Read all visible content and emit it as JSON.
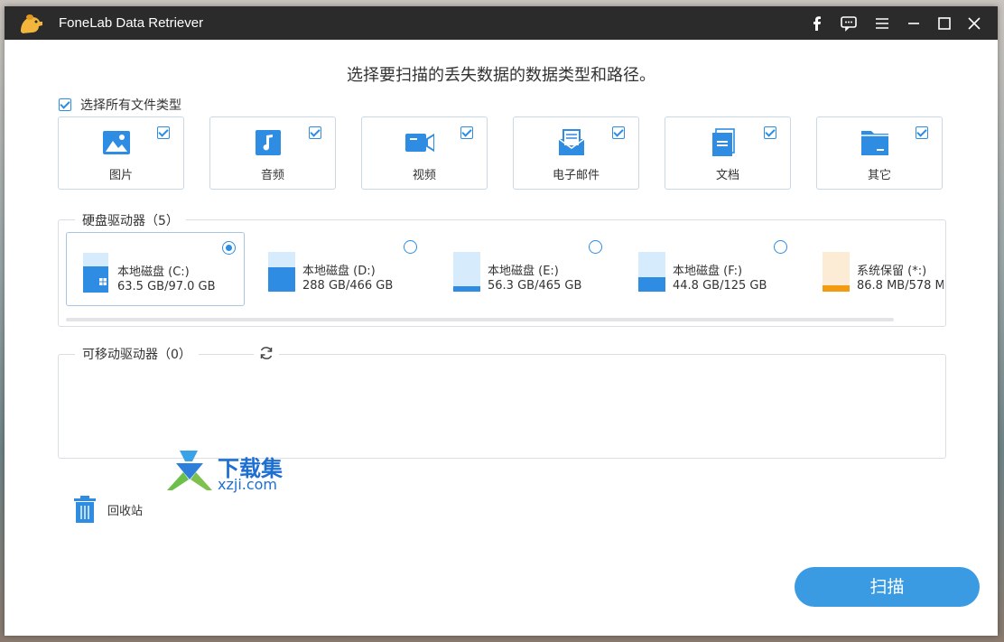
{
  "app": {
    "title": "FoneLab Data Retriever"
  },
  "titlebar_icons": [
    "facebook-icon",
    "feedback-icon",
    "menu-icon",
    "minimize-icon",
    "maximize-icon",
    "close-icon"
  ],
  "headline": "选择要扫描的丢失数据的数据类型和路径。",
  "select_all": {
    "label": "选择所有文件类型",
    "checked": true
  },
  "file_types": [
    {
      "label": "图片",
      "icon": "image-icon",
      "checked": true
    },
    {
      "label": "音频",
      "icon": "music-icon",
      "checked": true
    },
    {
      "label": "视频",
      "icon": "video-icon",
      "checked": true
    },
    {
      "label": "电子邮件",
      "icon": "email-icon",
      "checked": true
    },
    {
      "label": "文档",
      "icon": "document-icon",
      "checked": true
    },
    {
      "label": "其它",
      "icon": "other-icon",
      "checked": true
    }
  ],
  "hard_drives": {
    "title": "硬盘驱动器（5）",
    "items": [
      {
        "name": "本地磁盘 (C:)",
        "size": "63.5 GB/97.0 GB",
        "used_fraction": 0.65,
        "selected": true,
        "windows": true,
        "color": "#2e8ce2"
      },
      {
        "name": "本地磁盘 (D:)",
        "size": "288 GB/466 GB",
        "used_fraction": 0.62,
        "selected": false,
        "windows": false,
        "color": "#2e8ce2"
      },
      {
        "name": "本地磁盘 (E:)",
        "size": "56.3 GB/465 GB",
        "used_fraction": 0.12,
        "selected": false,
        "windows": false,
        "color": "#2e8ce2"
      },
      {
        "name": "本地磁盘 (F:)",
        "size": "44.8 GB/125 GB",
        "used_fraction": 0.36,
        "selected": false,
        "windows": false,
        "color": "#2e8ce2"
      },
      {
        "name": "系统保留 (*:)",
        "size": "86.8 MB/578 M",
        "used_fraction": 0.15,
        "selected": false,
        "windows": false,
        "color": "#f39c12"
      }
    ]
  },
  "removable_drives": {
    "title": "可移动驱动器（0）"
  },
  "recycle_bin": {
    "label": "回收站"
  },
  "scan_button": {
    "label": "扫描"
  },
  "watermark": {
    "title": "下载集",
    "subtitle": "xzji.com"
  },
  "colors": {
    "accent": "#2e8ce2",
    "titlebar": "#2b2b2b",
    "button": "#3a9be3"
  }
}
